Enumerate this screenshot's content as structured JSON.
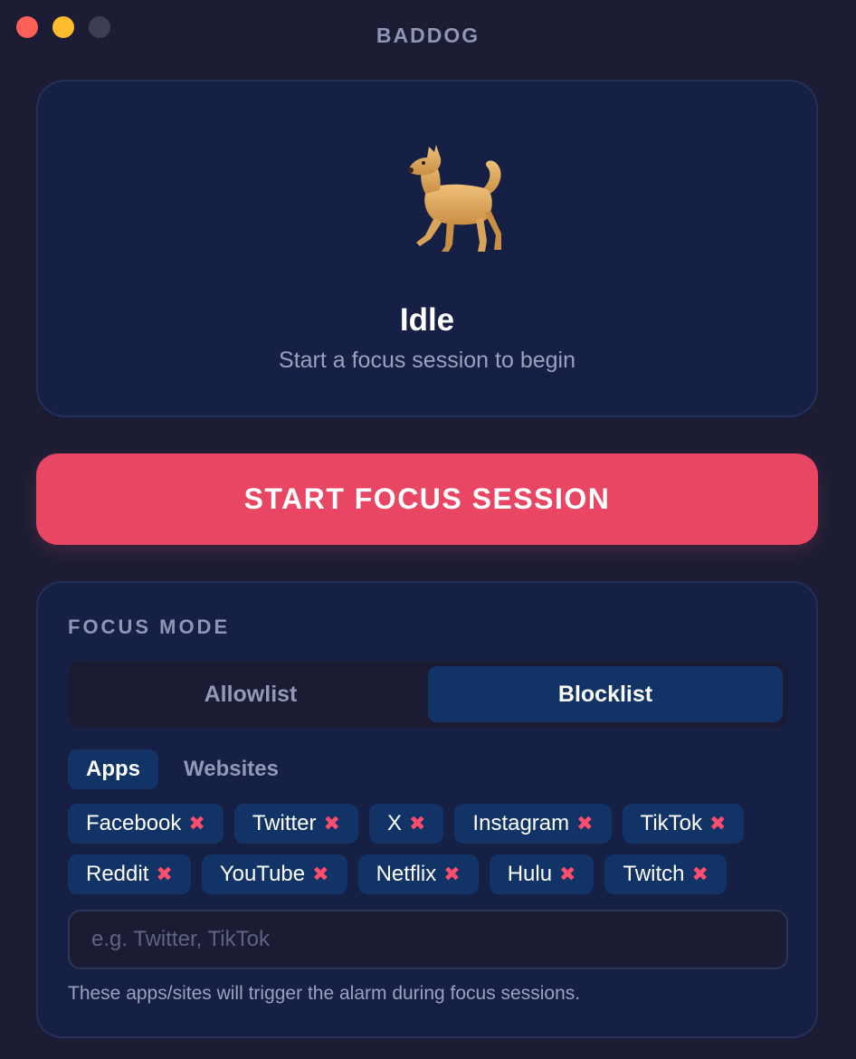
{
  "window": {
    "title": "BADDOG"
  },
  "status": {
    "icon": "dog-icon",
    "title": "Idle",
    "subtitle": "Start a focus session to begin"
  },
  "start_button": {
    "label": "START FOCUS SESSION"
  },
  "focus_mode": {
    "label": "FOCUS MODE",
    "modes": [
      {
        "label": "Allowlist",
        "selected": false
      },
      {
        "label": "Blocklist",
        "selected": true
      }
    ],
    "subtabs": [
      {
        "label": "Apps",
        "selected": true
      },
      {
        "label": "Websites",
        "selected": false
      }
    ],
    "remove_glyph": "✖",
    "tags": [
      "Facebook",
      "Twitter",
      "X",
      "Instagram",
      "TikTok",
      "Reddit",
      "YouTube",
      "Netflix",
      "Hulu",
      "Twitch"
    ],
    "input": {
      "placeholder": "e.g. Twitter, TikTok",
      "value": ""
    },
    "hint": "These apps/sites will trigger the alarm during focus sessions."
  },
  "colors": {
    "background": "#1c1d34",
    "card": "#162044",
    "accent": "#e84662",
    "selected": "#123366",
    "remove": "#ff4d6d"
  }
}
